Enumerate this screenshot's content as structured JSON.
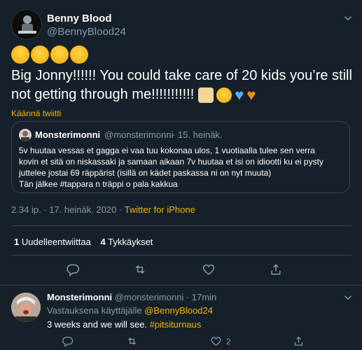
{
  "colors": {
    "background": "#15202b",
    "accent": "#f4b400",
    "muted": "#8899a6",
    "divider": "#38444d"
  },
  "tweet": {
    "author_name": "Benny Blood",
    "author_handle": "@BennyBlood24",
    "emoji_line": "😂😂😂😂",
    "text_line1": "Big Jonny!!!!!! You could take care of 20 kids you’re still",
    "text_line2": "not getting through me!!!!!!!!!!!",
    "translate_label": "Käännä twiitti",
    "timestamp": "2.34 ip. · 17. heinäk. 2020 · ",
    "source": "Twitter for iPhone",
    "retweets_count": "1",
    "retweets_label": "Uudelleentwiittaa",
    "likes_count": "4",
    "likes_label": "Tykkäykset"
  },
  "quote": {
    "author_name": "Monsterimonni",
    "author_handle": "@monsterimonni",
    "date": "· 15. heinäk.",
    "lines": [
      "5v huutaa vessas et gagga ei vaa tuu kokonaa ulos, 1 vuotiaalla tulee sen verra",
      "kovin et sitä on niskassaki ja samaan aikaan 7v huutaa et isi on idiootti ku ei pysty",
      "juttelee jostai 69 räppärist (isillä on kädet paskassa ni on nyt muuta)",
      "Tän jälkee #tappara n träppi o pala kakkua"
    ]
  },
  "reply": {
    "author_name": "Monsterimonni",
    "author_handle": "@monsterimonni",
    "time": "· 17min",
    "replying_prefix": "Vastauksena käyttäjälle ",
    "replying_to": "@BennyBlood24",
    "text": "3 weeks and we will see. ",
    "hashtag": "#pitsiturnaus",
    "likes_count": "2"
  },
  "icons": [
    "more-icon",
    "reply-icon",
    "retweet-icon",
    "like-icon",
    "share-icon"
  ]
}
